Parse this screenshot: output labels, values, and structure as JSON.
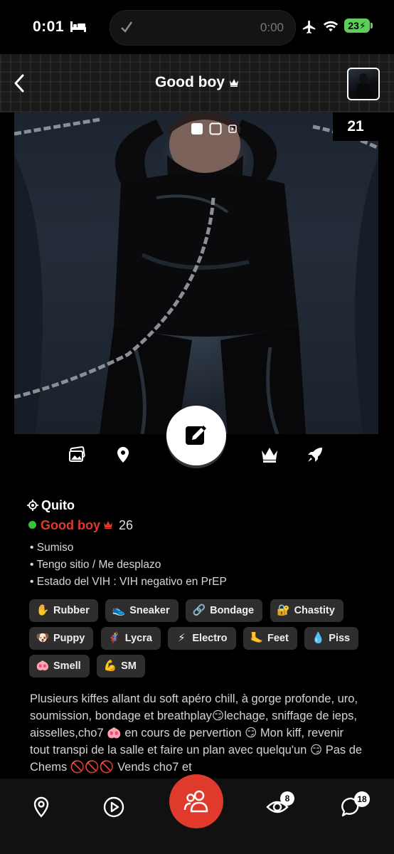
{
  "status_bar": {
    "time": "0:01",
    "island_timer": "0:00",
    "battery": "23"
  },
  "header": {
    "title": "Good boy"
  },
  "photo": {
    "count": "21"
  },
  "profile": {
    "city": "Quito",
    "name": "Good boy",
    "age": "26",
    "facts": [
      "• Sumiso",
      "• Tengo sitio / Me desplazo",
      "• Estado del VIH : VIH negativo en PrEP"
    ],
    "tags": [
      {
        "label": "Rubber",
        "icon": "✋"
      },
      {
        "label": "Sneaker",
        "icon": "👟"
      },
      {
        "label": "Bondage",
        "icon": "🔗"
      },
      {
        "label": "Chastity",
        "icon": "🔐"
      },
      {
        "label": "Puppy",
        "icon": "🐶"
      },
      {
        "label": "Lycra",
        "icon": "🦸"
      },
      {
        "label": "Electro",
        "icon": "⚡"
      },
      {
        "label": "Feet",
        "icon": "🦶"
      },
      {
        "label": "Piss",
        "icon": "💧"
      },
      {
        "label": "Smell",
        "icon": "🐽"
      },
      {
        "label": "SM",
        "icon": "💪"
      }
    ],
    "bio": "Plusieurs kiffes allant du soft apéro chill, à gorge profonde, uro, soumission, bondage et breathplay😏lechage, sniffage de ieps, aisselles,cho7 🐽 en cours de pervertion 😏 Mon kiff, revenir tout transpi de la salle et faire un plan avec quelqu'un 😏 Pas de Chems 🚫🚫🚫 Vends cho7 et"
  },
  "bottom_nav": {
    "views_badge": "8",
    "messages_badge": "18"
  },
  "colors": {
    "accent": "#e03a2c",
    "online": "#37c341"
  }
}
